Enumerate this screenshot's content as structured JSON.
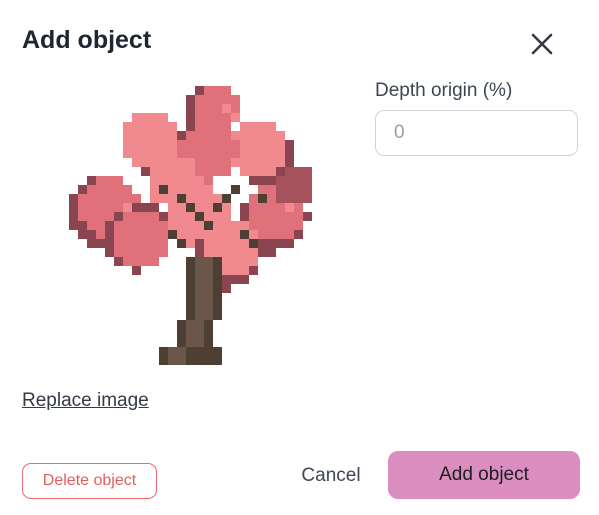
{
  "dialog": {
    "title": "Add object",
    "close_icon": "close-icon"
  },
  "image": {
    "icon": "pixel-art-cherry-blossom-tree",
    "colors": {
      "blossom_light": "#f08a8f",
      "blossom_mid": "#e07079",
      "blossom_dark": "#a6525c",
      "blossom_shadow": "#8a4550",
      "trunk": "#4e3f35",
      "trunk_light": "#6a574a"
    }
  },
  "depth_origin": {
    "label": "Depth origin (%)",
    "placeholder": "0"
  },
  "replace_image_label": "Replace image",
  "footer": {
    "delete_label": "Delete object",
    "cancel_label": "Cancel",
    "submit_label": "Add object"
  },
  "colors": {
    "primary": "#dc8dbf",
    "danger": "#ef6b6b"
  }
}
